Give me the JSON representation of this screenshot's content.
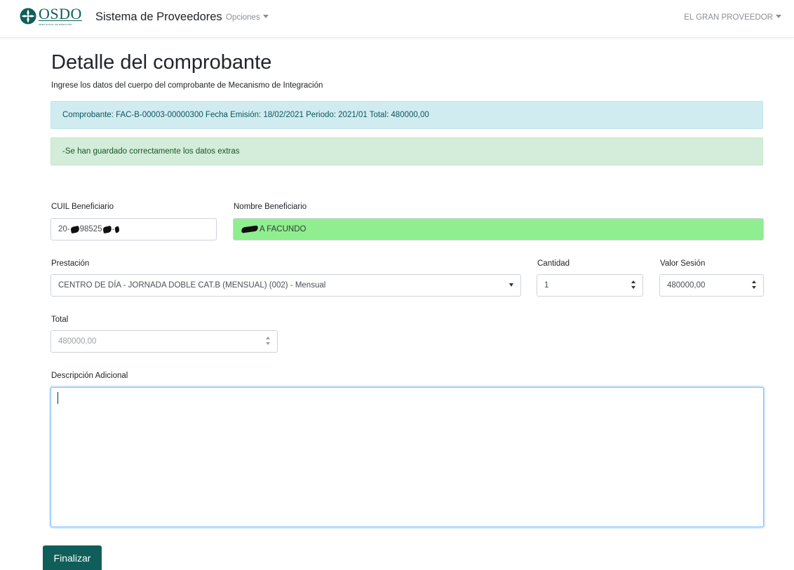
{
  "colors": {
    "brand": "#0f5e5a",
    "info_bg": "#d1ecf1",
    "success_bg": "#d4edda",
    "beneficiary_bg": "#90ee90",
    "button_bg": "#0f5e5a"
  },
  "navbar": {
    "brand_name": "OSDO",
    "brand_sub": "OBRA SOCIAL DE DIRECCION",
    "app_title": "Sistema de Proveedores",
    "options_label": "Opciones",
    "user_label": "EL GRAN PROVEEDOR",
    "logo_icon": "osdo-cross-logo-icon"
  },
  "header": {
    "title": "Detalle del comprobante",
    "subtitle": "Ingrese los datos del cuerpo del comprobante de Mecanismo de Integración"
  },
  "alerts": {
    "info": "Comprobante: FAC-B-00003-00000300 Fecha Emisión: 18/02/2021 Periodo: 2021/01 Total: 480000,00",
    "success": "-Se han guardado correctamente los datos extras"
  },
  "form": {
    "cuil_label": "CUIL Beneficiario",
    "cuil_value_start": "20-",
    "cuil_value_mid": "98525",
    "cuil_value_end": "-",
    "nombre_label": "Nombre Beneficiario",
    "nombre_value": "A FACUNDO",
    "prestacion_label": "Prestación",
    "prestacion_value": "CENTRO DE DÍA - JORNADA DOBLE CAT.B (MENSUAL) (002) - Mensual",
    "cantidad_label": "Cantidad",
    "cantidad_value": "1",
    "valor_label": "Valor Sesión",
    "valor_value": "480000,00",
    "total_label": "Total",
    "total_value": "480000,00",
    "descripcion_label": "Descripción Adicional",
    "descripcion_value": ""
  },
  "actions": {
    "finalizar_label": "Finalizar"
  }
}
